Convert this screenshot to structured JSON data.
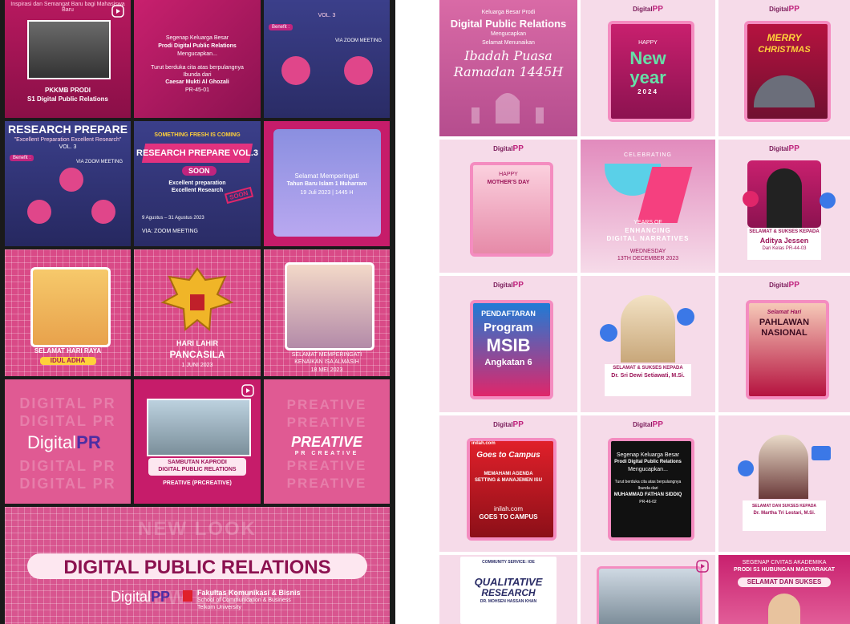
{
  "left": {
    "tiles": [
      {
        "line1": "PKKMB PRODI",
        "line2": "S1 Digital Public Relations",
        "top": "Inspirasi dan Semangat Baru bagi Mahasiswa Baru"
      },
      {
        "org": "Segenap Keluarga Besar",
        "prodi": "Prodi Digital Public Relations",
        "mengucapkan": "Mengucapkan...",
        "msg": "Turut berduka cita atas berpulangnya",
        "ibunda": "Ibunda dari",
        "name": "Caesar Mukti Al Ghozali",
        "cls": "PR-45-01"
      },
      {
        "vol": "VOL. 3",
        "tag": "Benefit :",
        "via": "VIA ZOOM MEETING"
      },
      {
        "title": "RESEARCH PREPARE",
        "subtitle": "\"Excellent Preparation Excellent Research\"",
        "vol": "VOL. 3",
        "tag": "Benefit :",
        "via": "VIA ZOOM MEETING"
      },
      {
        "coming": "SOMETHING FRESH IS COMING",
        "title": "RESEARCH PREPARE VOL.3",
        "soon": "SOON",
        "sub1": "Excellent preparation",
        "sub2": "Excellent Research",
        "stamp": "SOON",
        "date": "9 Agustus – 31 Agustus 2023",
        "via": "VIA: ZOOM MEETING"
      },
      {
        "line1": "Selamat Memperingati",
        "line2": "Tahun Baru Islam 1 Muharram",
        "date": "19 Juli 2023 | 1445 H"
      },
      {
        "line1": "SELAMAT HARI RAYA",
        "line2": "IDUL ADHA"
      },
      {
        "line1": "HARI LAHIR",
        "line2": "PANCASILA",
        "date": "1 JUNI 2023"
      },
      {
        "line1": "SELAMAT MEMPERINGATI",
        "line2": "KENAIKAN ISA ALMASIH",
        "date": "18 MEI 2023"
      },
      {
        "bg": "DIGITAL PR",
        "logo1": "Digital",
        "logo2": "PR"
      },
      {
        "line1": "SAMBUTAN KAPRODI",
        "line2": "DIGITAL PUBLIC RELATIONS",
        "line3": "PREATIVE (PRCREATIVE)"
      },
      {
        "bg": "PREATIVE",
        "logo": "PREATIVE",
        "sub": "PR CREATIVE"
      }
    ],
    "banner": {
      "ghost": "NEW LOOK",
      "title": "DIGITAL PUBLIC RELATIONS",
      "logo1": "Digital",
      "logo2": "PP",
      "faculty": "Fakultas Komunikasi & Bisnis",
      "school": "School of Communication & Business",
      "univ": "Telkom University"
    }
  },
  "right": {
    "header_logo1": "Digital",
    "header_logo2": "PP",
    "tiles": [
      {
        "top": "Keluarga Besar Prodi",
        "title": "Digital Public Relations",
        "sub": "Mengucapkan",
        "msg1": "Selamat Menunaikan",
        "msg2": "Ibadah Puasa",
        "msg3": "Ramadan 1445H"
      },
      {
        "line1": "HAPPY",
        "line2": "New",
        "line3": "year",
        "year": "2024"
      },
      {
        "line1": "MERRY",
        "line2": "CHRISTMAS"
      },
      {
        "line1": "HAPPY",
        "line2": "MOTHER'S DAY"
      },
      {
        "top": "CELEBRATING",
        "years": "YEARS OF",
        "line1": "ENHANCING",
        "line2": "DIGITAL NARRATIVES",
        "day": "WEDNESDAY",
        "date": "13TH DECEMBER 2023"
      },
      {
        "line1": "SELAMAT & SUKSES KEPADA",
        "name": "Aditya Jessen",
        "cls": "Dari Kelas PR-44-03"
      },
      {
        "line1": "PENDAFTARAN",
        "line2": "Program",
        "line3": "MSIB",
        "line4": "Angkatan 6"
      },
      {
        "line1": "SELAMAT & SUKSES KEPADA",
        "name": "Dr. Sri Dewi Setiawati, M.Si."
      },
      {
        "line1": "Selamat Hari",
        "line2": "PAHLAWAN",
        "line3": "NASIONAL"
      },
      {
        "brand": "inilah.com",
        "line1": "Goes to Campus",
        "line2": "MEMAHAMI AGENDA",
        "line3": "SETTING & MANAJEMEN ISU",
        "line4": "inilah.com",
        "line5": "GOES TO CAMPUS"
      },
      {
        "org": "Segenap Keluarga Besar",
        "prodi": "Prodi Digital Public Relations",
        "mengucapkan": "Mengucapkan...",
        "msg": "Turut berduka cita atas berpulangnya",
        "ibunda": "Ibunda dari",
        "name": "MUHAMMAD FATHAN SIDDIQ",
        "cls": "PR-46-02"
      },
      {
        "line1": "SELAMAT DAN SUKSES KEPADA",
        "name": "Dr. Martha Tri Lestari, M.Si."
      },
      {
        "top": "COMMUNITY SERVICE: IOE",
        "line1": "QUALITATIVE",
        "line2": "RESEARCH",
        "name": "DR. MOHSEN HASSAN KHAN"
      },
      {
        "desc": "building"
      },
      {
        "top1": "SEGENAP CIVITAS AKADEMIKA",
        "top2": "PRODI S1 HUBUNGAN MASYARAKAT",
        "line1": "SELAMAT DAN SUKSES"
      }
    ]
  }
}
